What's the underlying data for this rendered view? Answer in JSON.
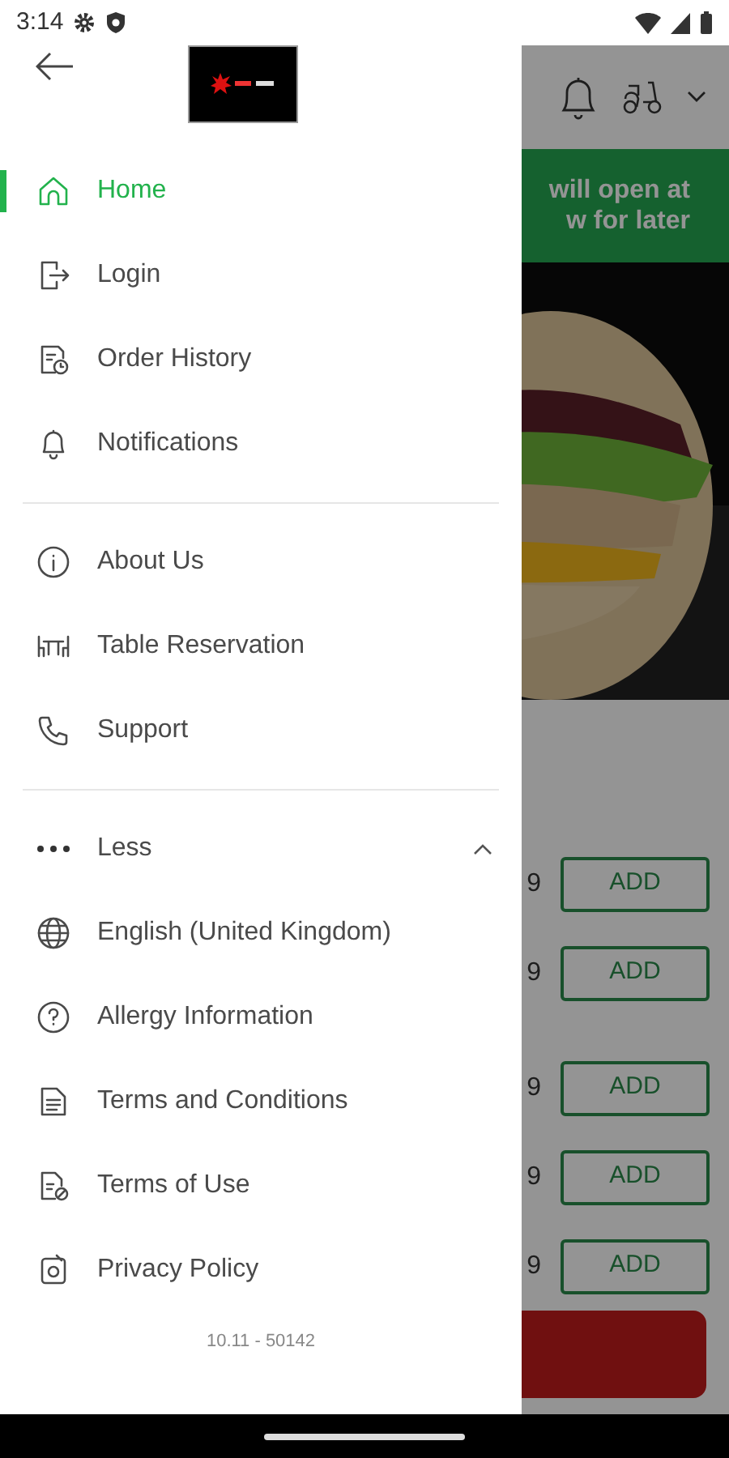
{
  "status_bar": {
    "time": "3:14"
  },
  "drawer": {
    "sections": [
      {
        "items": [
          {
            "label": "Home",
            "selected": true
          },
          {
            "label": "Login",
            "selected": false
          },
          {
            "label": "Order History",
            "selected": false
          },
          {
            "label": "Notifications",
            "selected": false
          }
        ]
      },
      {
        "items": [
          {
            "label": "About Us",
            "selected": false
          },
          {
            "label": "Table Reservation",
            "selected": false
          },
          {
            "label": "Support",
            "selected": false
          }
        ]
      }
    ],
    "expander": {
      "label": "Less",
      "expanded": true
    },
    "more_items": [
      {
        "label": "English (United Kingdom)",
        "selected": false
      },
      {
        "label": "Allergy Information",
        "selected": false
      },
      {
        "label": "Terms and Conditions",
        "selected": false
      },
      {
        "label": "Terms of Use",
        "selected": false
      },
      {
        "label": "Privacy Policy",
        "selected": false
      }
    ],
    "version": "10.11 - 50142"
  },
  "background": {
    "banner_lines": [
      "will open at",
      "w for later"
    ],
    "menu_rows": [
      {
        "price": "9",
        "button": "ADD"
      },
      {
        "price": "9",
        "button": "ADD"
      },
      {
        "price": "9",
        "button": "ADD"
      },
      {
        "price": "9",
        "button": "ADD"
      },
      {
        "price": "9",
        "button": "ADD"
      }
    ]
  }
}
